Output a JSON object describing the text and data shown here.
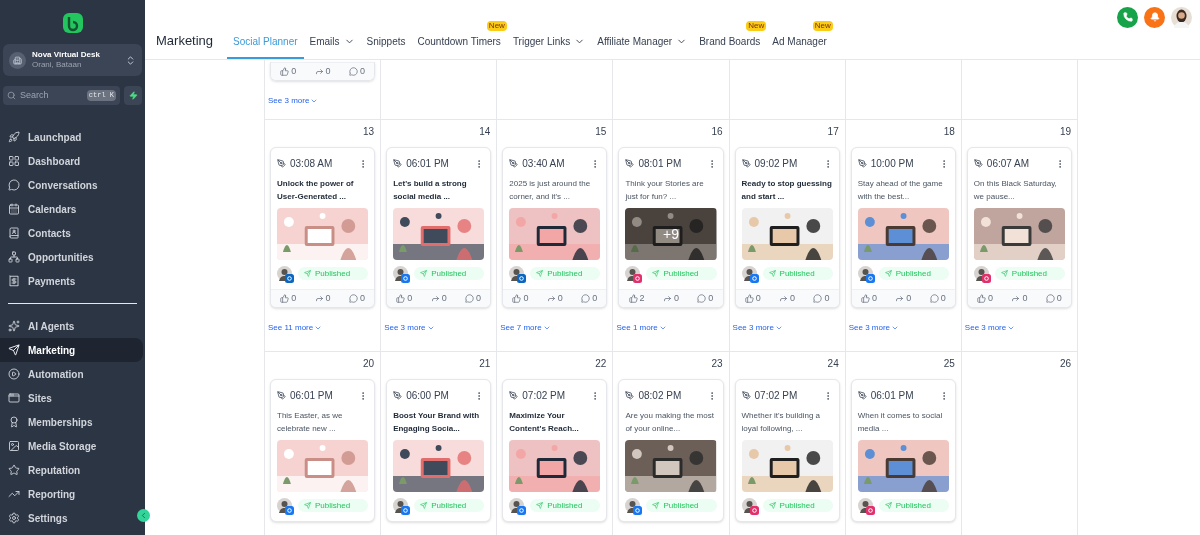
{
  "sidebar": {
    "location": {
      "name": "Nova Virtual Desk",
      "place": "Orani, Bataan"
    },
    "search": {
      "placeholder": "Search",
      "shortcut": "ctrl K"
    },
    "groups": [
      [
        {
          "label": "Launchpad",
          "selected": false
        },
        {
          "label": "Dashboard",
          "selected": false
        },
        {
          "label": "Conversations",
          "selected": false
        },
        {
          "label": "Calendars",
          "selected": false
        },
        {
          "label": "Contacts",
          "selected": false
        },
        {
          "label": "Opportunities",
          "selected": false
        },
        {
          "label": "Payments",
          "selected": false
        }
      ],
      [
        {
          "label": "AI Agents",
          "selected": false
        },
        {
          "label": "Marketing",
          "selected": true
        },
        {
          "label": "Automation",
          "selected": false
        },
        {
          "label": "Sites",
          "selected": false
        },
        {
          "label": "Memberships",
          "selected": false
        },
        {
          "label": "Media Storage",
          "selected": false
        },
        {
          "label": "Reputation",
          "selected": false
        },
        {
          "label": "Reporting",
          "selected": false
        }
      ]
    ],
    "footer": {
      "label": "Settings",
      "selected": false
    }
  },
  "header": {
    "title": "Marketing",
    "tabs": [
      {
        "label": "Social Planner",
        "selected": true,
        "dropdown": false
      },
      {
        "label": "Emails",
        "selected": false,
        "dropdown": true
      },
      {
        "label": "Snippets",
        "selected": false,
        "dropdown": false
      },
      {
        "label": "Countdown Timers",
        "selected": false,
        "dropdown": false,
        "badge": "New"
      },
      {
        "label": "Trigger Links",
        "selected": false,
        "dropdown": true
      },
      {
        "label": "Affiliate Manager",
        "selected": false,
        "dropdown": true
      },
      {
        "label": "Brand Boards",
        "selected": false,
        "dropdown": false,
        "badge": "New"
      },
      {
        "label": "Ad Manager",
        "selected": false,
        "dropdown": false,
        "badge": "New"
      }
    ]
  },
  "weeks": [
    {
      "days": [
        {
          "kind": "day",
          "posts": [
            {
              "kind": "tail",
              "likes": "0",
              "shares": "0",
              "comments": "0"
            }
          ],
          "see_more": "See 3 more"
        },
        {
          "kind": "blank"
        },
        {
          "kind": "blank"
        },
        {
          "kind": "blank"
        },
        {
          "kind": "blank"
        },
        {
          "kind": "blank"
        },
        {
          "kind": "blank"
        }
      ]
    },
    {
      "days": [
        {
          "kind": "day",
          "date": "13",
          "posts": [
            {
              "kind": "full",
              "time": "03:08 AM",
              "text": "Unlock the power of User-Generated ...",
              "bold": true,
              "color": "#0a66c2",
              "status": "Published",
              "likes": "0",
              "shares": "0",
              "comments": "0"
            }
          ],
          "see_more": "See 11 more"
        },
        {
          "kind": "day",
          "date": "14",
          "posts": [
            {
              "kind": "full",
              "time": "06:01 PM",
              "text": "Let's build a strong social media ...",
              "bold": true,
              "color": "#1877f2",
              "status": "Published",
              "likes": "0",
              "shares": "0",
              "comments": "0"
            }
          ],
          "see_more": "See 3 more"
        },
        {
          "kind": "day",
          "date": "15",
          "posts": [
            {
              "kind": "full",
              "time": "03:40 AM",
              "text": "2025 is just around the corner, and it's ...",
              "bold": false,
              "color": "#0a66c2",
              "status": "Published",
              "likes": "0",
              "shares": "0",
              "comments": "0"
            }
          ],
          "see_more": "See 7 more"
        },
        {
          "kind": "day",
          "date": "16",
          "posts": [
            {
              "kind": "full",
              "time": "08:01 PM",
              "text": "Think your Stories are just for fun? ...",
              "bold": false,
              "color": "#e1306c",
              "overlay": "+9",
              "status": "Published",
              "likes": "2",
              "shares": "0",
              "comments": "0"
            }
          ],
          "see_more": "See 1 more"
        },
        {
          "kind": "day",
          "date": "17",
          "posts": [
            {
              "kind": "full",
              "time": "09:02 PM",
              "text": "Ready to stop guessing and start ...",
              "bold": true,
              "color": "#1877f2",
              "status": "Published",
              "likes": "0",
              "shares": "0",
              "comments": "0"
            }
          ],
          "see_more": "See 3 more"
        },
        {
          "kind": "day",
          "date": "18",
          "posts": [
            {
              "kind": "full",
              "time": "10:00 PM",
              "text": "Stay ahead of the game with the best...",
              "bold": false,
              "color": "#1877f2",
              "status": "Published",
              "likes": "0",
              "shares": "0",
              "comments": "0"
            }
          ],
          "see_more": "See 3 more"
        },
        {
          "kind": "day",
          "date": "19",
          "posts": [
            {
              "kind": "full",
              "time": "06:07 AM",
              "text": "On this Black Saturday, we pause...",
              "bold": false,
              "color": "#e1306c",
              "status": "Published",
              "likes": "0",
              "shares": "0",
              "comments": "0"
            }
          ],
          "see_more": "See 3 more"
        }
      ]
    },
    {
      "days": [
        {
          "kind": "day",
          "date": "20",
          "posts": [
            {
              "kind": "full",
              "time": "06:01 PM",
              "text": "This Easter, as we celebrate new ...",
              "bold": false,
              "color": "#1877f2",
              "status": "Published"
            }
          ]
        },
        {
          "kind": "day",
          "date": "21",
          "posts": [
            {
              "kind": "full",
              "time": "06:00 PM",
              "text": "Boost Your Brand with Engaging Socia...",
              "bold": true,
              "color": "#1877f2",
              "status": "Published"
            }
          ]
        },
        {
          "kind": "day",
          "date": "22",
          "posts": [
            {
              "kind": "full",
              "time": "07:02 PM",
              "text": "Maximize Your Content's Reach...",
              "bold": true,
              "color": "#1877f2",
              "status": "Published"
            }
          ]
        },
        {
          "kind": "day",
          "date": "23",
          "posts": [
            {
              "kind": "full",
              "time": "08:02 PM",
              "text": "Are you making the most of your online...",
              "bold": false,
              "color": "#1877f2",
              "status": "Published"
            }
          ]
        },
        {
          "kind": "day",
          "date": "24",
          "posts": [
            {
              "kind": "full",
              "time": "07:02 PM",
              "text": "Whether it's building a loyal following, ...",
              "bold": false,
              "color": "#e1306c",
              "status": "Published"
            }
          ]
        },
        {
          "kind": "day",
          "date": "25",
          "posts": [
            {
              "kind": "full",
              "time": "06:01 PM",
              "text": "When it comes to social media ...",
              "bold": false,
              "color": "#e1306c",
              "status": "Published"
            }
          ]
        },
        {
          "kind": "day",
          "date": "26"
        }
      ]
    }
  ]
}
